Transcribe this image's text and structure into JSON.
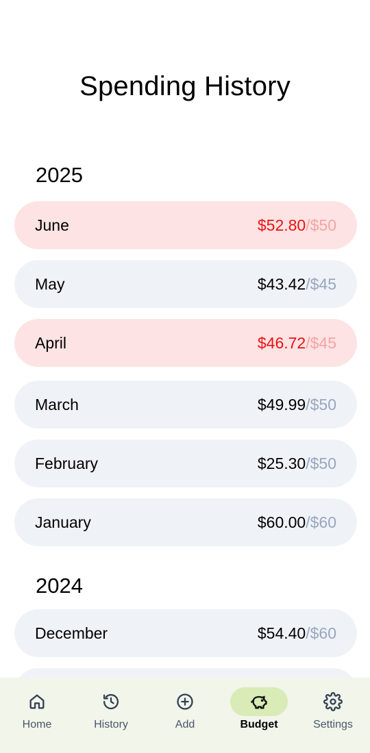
{
  "title": "Spending History",
  "colors": {
    "row_bg": "#eff3f8",
    "row_over_bg": "#fde3e3",
    "over_text": "#ed1111",
    "budget_text": "#98a6bd",
    "nav_bg": "#f1f5ea",
    "nav_active_bg": "#d9ebb6"
  },
  "years": [
    {
      "year": "2025",
      "months": [
        {
          "month": "June",
          "spent": "$52.80",
          "budget": "/$50",
          "over": true
        },
        {
          "month": "May",
          "spent": "$43.42",
          "budget": "/$45",
          "over": false
        },
        {
          "month": "April",
          "spent": "$46.72",
          "budget": "/$45",
          "over": true
        },
        {
          "month": "March",
          "spent": "$49.99",
          "budget": "/$50",
          "over": false
        },
        {
          "month": "February",
          "spent": "$25.30",
          "budget": "/$50",
          "over": false
        },
        {
          "month": "January",
          "spent": "$60.00",
          "budget": "/$60",
          "over": false
        }
      ]
    },
    {
      "year": "2024",
      "months": [
        {
          "month": "December",
          "spent": "$54.40",
          "budget": "/$60",
          "over": false
        }
      ]
    }
  ],
  "nav": [
    {
      "label": "Home",
      "icon": "home-icon",
      "active": false
    },
    {
      "label": "History",
      "icon": "history-icon",
      "active": false
    },
    {
      "label": "Add",
      "icon": "add-circle-icon",
      "active": false
    },
    {
      "label": "Budget",
      "icon": "piggy-bank-icon",
      "active": true
    },
    {
      "label": "Settings",
      "icon": "gear-icon",
      "active": false
    }
  ]
}
